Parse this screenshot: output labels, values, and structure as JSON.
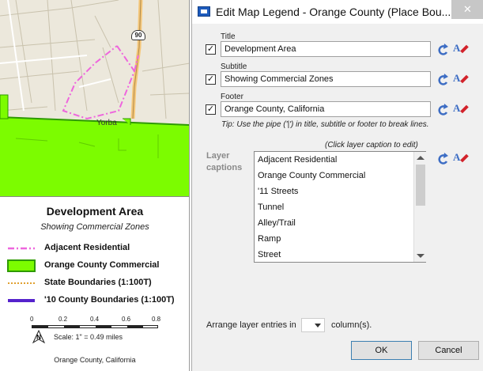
{
  "map": {
    "place_label": "Yorba",
    "highway_shield": "90",
    "legend": {
      "title": "Development Area",
      "subtitle": "Showing Commercial Zones",
      "entries": [
        {
          "label": "Adjacent Residential",
          "color": "#ee66dd",
          "icon": "dash-dot-line"
        },
        {
          "label": "Orange County Commercial",
          "color": "#7cfc00",
          "icon": "fill-box"
        },
        {
          "label": "State Boundaries (1:100T)",
          "color": "#e0a030",
          "icon": "dotted-line"
        },
        {
          "label": "'10 County Boundaries (1:100T)",
          "color": "#5522cc",
          "icon": "thick-line"
        }
      ],
      "scale": {
        "ticks": [
          "0",
          "0.2",
          "0.4",
          "0.6",
          "0.8"
        ],
        "north_label": "N",
        "text": "Scale: 1\" = 0.49 miles"
      },
      "footer": "Orange County, California"
    }
  },
  "dialog": {
    "title": "Edit Map Legend - Orange County (Place Bou...",
    "close_glyph": "✕",
    "title_field": {
      "label": "Title",
      "value": "Development Area",
      "checked": "✓"
    },
    "subtitle_field": {
      "label": "Subtitle",
      "value": "Showing Commercial Zones",
      "checked": "✓"
    },
    "footer_field": {
      "label": "Footer",
      "value": "Orange County, California",
      "checked": "✓"
    },
    "tip": "Tip: Use the pipe ('|') in title, subtitle or footer to break lines.",
    "layer_hint": "(Click layer caption to edit)",
    "layer_captions_label": "Layer captions",
    "layers": [
      "Adjacent Residential",
      "Orange County Commercial",
      "'11 Streets",
      "Tunnel",
      "Alley/Trail",
      "Ramp",
      "Street"
    ],
    "arrange_prefix": "Arrange layer entries in",
    "arrange_suffix": "column(s).",
    "ok_label": "OK",
    "cancel_label": "Cancel",
    "accent_blue": "#3d6dc4",
    "icons": [
      "undo-icon",
      "font-edit-icon",
      "app-icon",
      "close-icon",
      "north-arrow-icon"
    ]
  }
}
